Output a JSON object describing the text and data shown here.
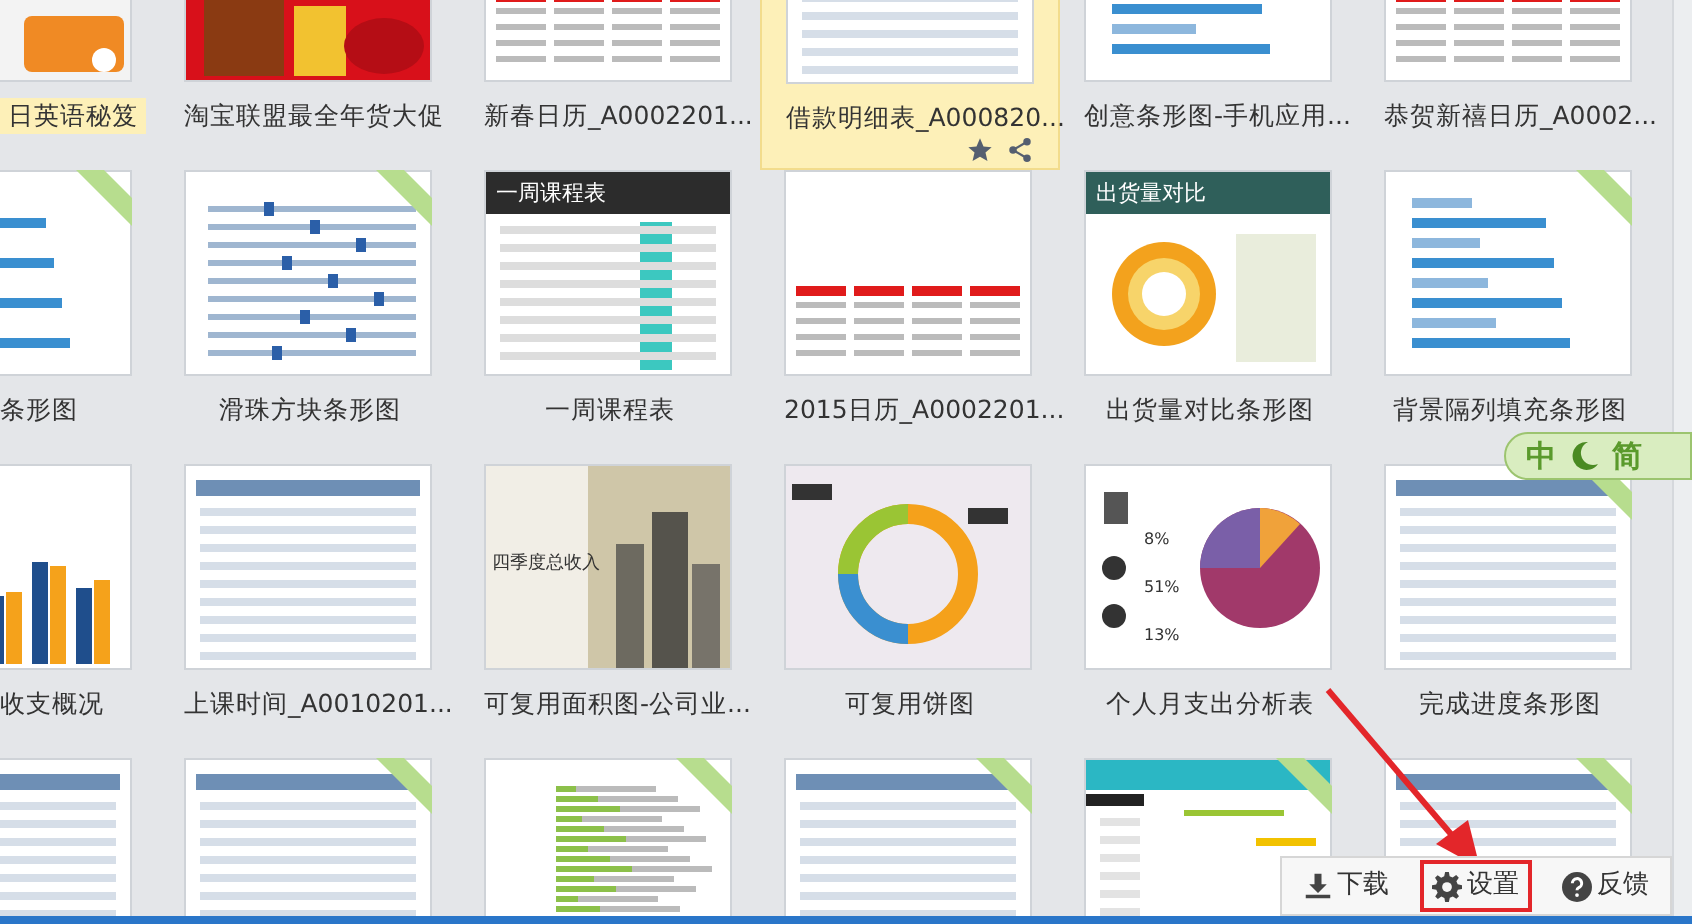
{
  "gallery": {
    "rows": [
      {
        "items": [
          {
            "label": "日英语秘笈",
            "selected": false,
            "kind": "ad"
          },
          {
            "label": "淘宝联盟最全年货大促",
            "selected": false,
            "kind": "promo"
          },
          {
            "label": "新春日历_A0002201...",
            "selected": false,
            "kind": "calendar"
          },
          {
            "label": "借款明细表_A000820...",
            "selected": true,
            "kind": "table"
          },
          {
            "label": "创意条形图-手机应用...",
            "selected": false,
            "kind": "bars"
          },
          {
            "label": "恭贺新禧日历_A0002...",
            "selected": false,
            "kind": "calendar"
          }
        ]
      },
      {
        "items": [
          {
            "label": "条形图",
            "selected": false,
            "vip": true,
            "kind": "bars"
          },
          {
            "label": "滑珠方块条形图",
            "selected": false,
            "vip": true,
            "kind": "slider"
          },
          {
            "label": "一周课程表",
            "selected": false,
            "vip": false,
            "kind": "timetable",
            "thumb_title": "一周课程表"
          },
          {
            "label": "2015日历_A0002201...",
            "selected": false,
            "vip": false,
            "kind": "calendar"
          },
          {
            "label": "出货量对比条形图",
            "selected": false,
            "vip": false,
            "kind": "donut",
            "thumb_title": "出货量对比"
          },
          {
            "label": "背景隔列填充条形图",
            "selected": false,
            "vip": true,
            "kind": "bars"
          }
        ]
      },
      {
        "items": [
          {
            "label": "收支概况",
            "selected": false,
            "vip": false,
            "kind": "columns"
          },
          {
            "label": "上课时间_A0010201...",
            "selected": false,
            "vip": false,
            "kind": "table"
          },
          {
            "label": "可复用面积图-公司业...",
            "selected": false,
            "vip": false,
            "thumb_title": "四季度总收入"
          },
          {
            "label": "可复用饼图",
            "selected": false,
            "vip": false,
            "kind": "ring"
          },
          {
            "label": "个人月支出分析表",
            "selected": false,
            "vip": false,
            "kind": "pie",
            "thumb_values": [
              "8%",
              "51%",
              "13%"
            ]
          },
          {
            "label": "完成进度条形图",
            "selected": false,
            "vip": true,
            "kind": "table"
          }
        ]
      },
      {
        "items": [
          {
            "selected": false,
            "vip": false,
            "kind": "table"
          },
          {
            "selected": false,
            "vip": true,
            "kind": "table"
          },
          {
            "selected": false,
            "vip": true,
            "kind": "greenbars"
          },
          {
            "selected": false,
            "vip": true,
            "kind": "table"
          },
          {
            "selected": false,
            "vip": true,
            "kind": "gantt"
          },
          {
            "selected": false,
            "vip": true,
            "kind": "table"
          }
        ]
      }
    ]
  },
  "ime": {
    "mode": "中",
    "charset": "简"
  },
  "toolbar": [
    {
      "label": "下载",
      "kind": "download",
      "highlighted": false
    },
    {
      "label": "设置",
      "kind": "settings",
      "highlighted": true
    },
    {
      "label": "反馈",
      "kind": "feedback",
      "highlighted": false
    }
  ]
}
